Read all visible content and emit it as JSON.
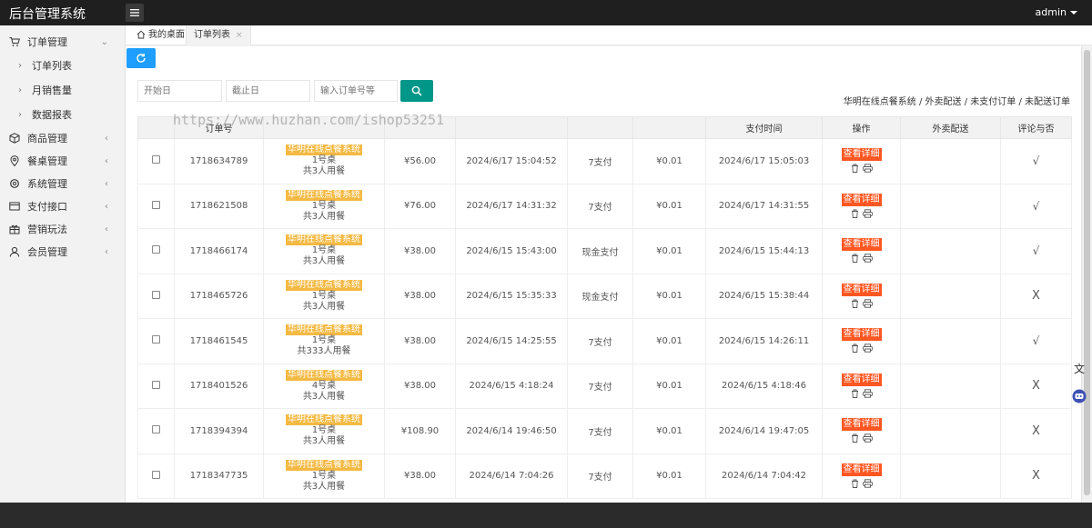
{
  "header": {
    "brand": "后台管理系统",
    "user": "admin"
  },
  "sidebar": {
    "groups": [
      {
        "label": "订单管理",
        "icon": "cart-icon",
        "expanded": true,
        "children": [
          "订单列表",
          "月销售量",
          "数据报表"
        ]
      },
      {
        "label": "商品管理",
        "icon": "cube-icon"
      },
      {
        "label": "餐桌管理",
        "icon": "location-icon"
      },
      {
        "label": "系统管理",
        "icon": "gear-icon"
      },
      {
        "label": "支付接口",
        "icon": "card-icon"
      },
      {
        "label": "营销玩法",
        "icon": "gift-icon"
      },
      {
        "label": "会员管理",
        "icon": "user-icon"
      }
    ]
  },
  "tabs": [
    {
      "label": "我的桌面",
      "icon": "home-icon"
    },
    {
      "label": "订单列表",
      "close": "×"
    }
  ],
  "filters": {
    "start_placeholder": "开始日",
    "end_placeholder": "截止日",
    "order_placeholder": "输入订单号等"
  },
  "breadcrumb": "华明在线点餐系统 / 外卖配送 / 未支付订单 / 未配送订单",
  "watermark": "https://www.huzhan.com/ishop53251",
  "table": {
    "headers": [
      "",
      "订单号",
      "",
      "",
      "",
      "",
      "",
      "支付时间",
      "操作",
      "外卖配送",
      "评论与否"
    ],
    "view_label": "查看详细",
    "rows": [
      {
        "id": "1718634789",
        "shop": "华明在线点餐系统",
        "table": "1号桌",
        "people": "共3人用餐",
        "price": "¥56.00",
        "time": "2024/6/17 15:04:52",
        "pay": "7支付",
        "pay_type": "wx",
        "amount": "¥0.01",
        "paid_time": "2024/6/17 15:05:03",
        "delivery": "",
        "review": "√"
      },
      {
        "id": "1718621508",
        "shop": "华明在线点餐系统",
        "table": "1号桌",
        "people": "共3人用餐",
        "price": "¥76.00",
        "time": "2024/6/17 14:31:32",
        "pay": "7支付",
        "pay_type": "wx",
        "amount": "¥0.01",
        "paid_time": "2024/6/17 14:31:55",
        "delivery": "",
        "review": "√"
      },
      {
        "id": "1718466174",
        "shop": "华明在线点餐系统",
        "table": "1号桌",
        "people": "共3人用餐",
        "price": "¥38.00",
        "time": "2024/6/15 15:43:00",
        "pay": "现金支付",
        "pay_type": "cash",
        "amount": "¥0.01",
        "paid_time": "2024/6/15 15:44:13",
        "delivery": "",
        "review": "√"
      },
      {
        "id": "1718465726",
        "shop": "华明在线点餐系统",
        "table": "1号桌",
        "people": "共3人用餐",
        "price": "¥38.00",
        "time": "2024/6/15 15:35:33",
        "pay": "现金支付",
        "pay_type": "cash",
        "amount": "¥0.01",
        "paid_time": "2024/6/15 15:38:44",
        "delivery": "",
        "review": "X"
      },
      {
        "id": "1718461545",
        "shop": "华明在线点餐系统",
        "table": "1号桌",
        "people": "共333人用餐",
        "price": "¥38.00",
        "time": "2024/6/15 14:25:55",
        "pay": "7支付",
        "pay_type": "wx",
        "amount": "¥0.01",
        "paid_time": "2024/6/15 14:26:11",
        "delivery": "",
        "review": "√"
      },
      {
        "id": "1718401526",
        "shop": "华明在线点餐系统",
        "table": "4号桌",
        "people": "共3人用餐",
        "price": "¥38.00",
        "time": "2024/6/15 4:18:24",
        "pay": "7支付",
        "pay_type": "wx",
        "amount": "¥0.01",
        "paid_time": "2024/6/15 4:18:46",
        "delivery": "",
        "review": "X"
      },
      {
        "id": "1718394394",
        "shop": "华明在线点餐系统",
        "table": "1号桌",
        "people": "共3人用餐",
        "price": "¥108.90",
        "time": "2024/6/14 19:46:50",
        "pay": "7支付",
        "pay_type": "wx",
        "amount": "¥0.01",
        "paid_time": "2024/6/14 19:47:05",
        "delivery": "",
        "review": "X"
      },
      {
        "id": "1718347735",
        "shop": "华明在线点餐系统",
        "table": "1号桌",
        "people": "共3人用餐",
        "price": "¥38.00",
        "time": "2024/6/14 7:04:26",
        "pay": "7支付",
        "pay_type": "wx",
        "amount": "¥0.01",
        "paid_time": "2024/6/14 7:04:42",
        "delivery": "",
        "review": "X"
      }
    ]
  },
  "colors": {
    "header_bg": "#1f1f1f",
    "refresh_btn": "#1e9fff",
    "search_btn": "#009688",
    "view_btn": "#ff5722",
    "shop_badge": "#f4b942",
    "amount": "#cc0000"
  },
  "floating": {
    "translate_icon": "translate-icon",
    "assistant_icon": "assistant-icon"
  }
}
